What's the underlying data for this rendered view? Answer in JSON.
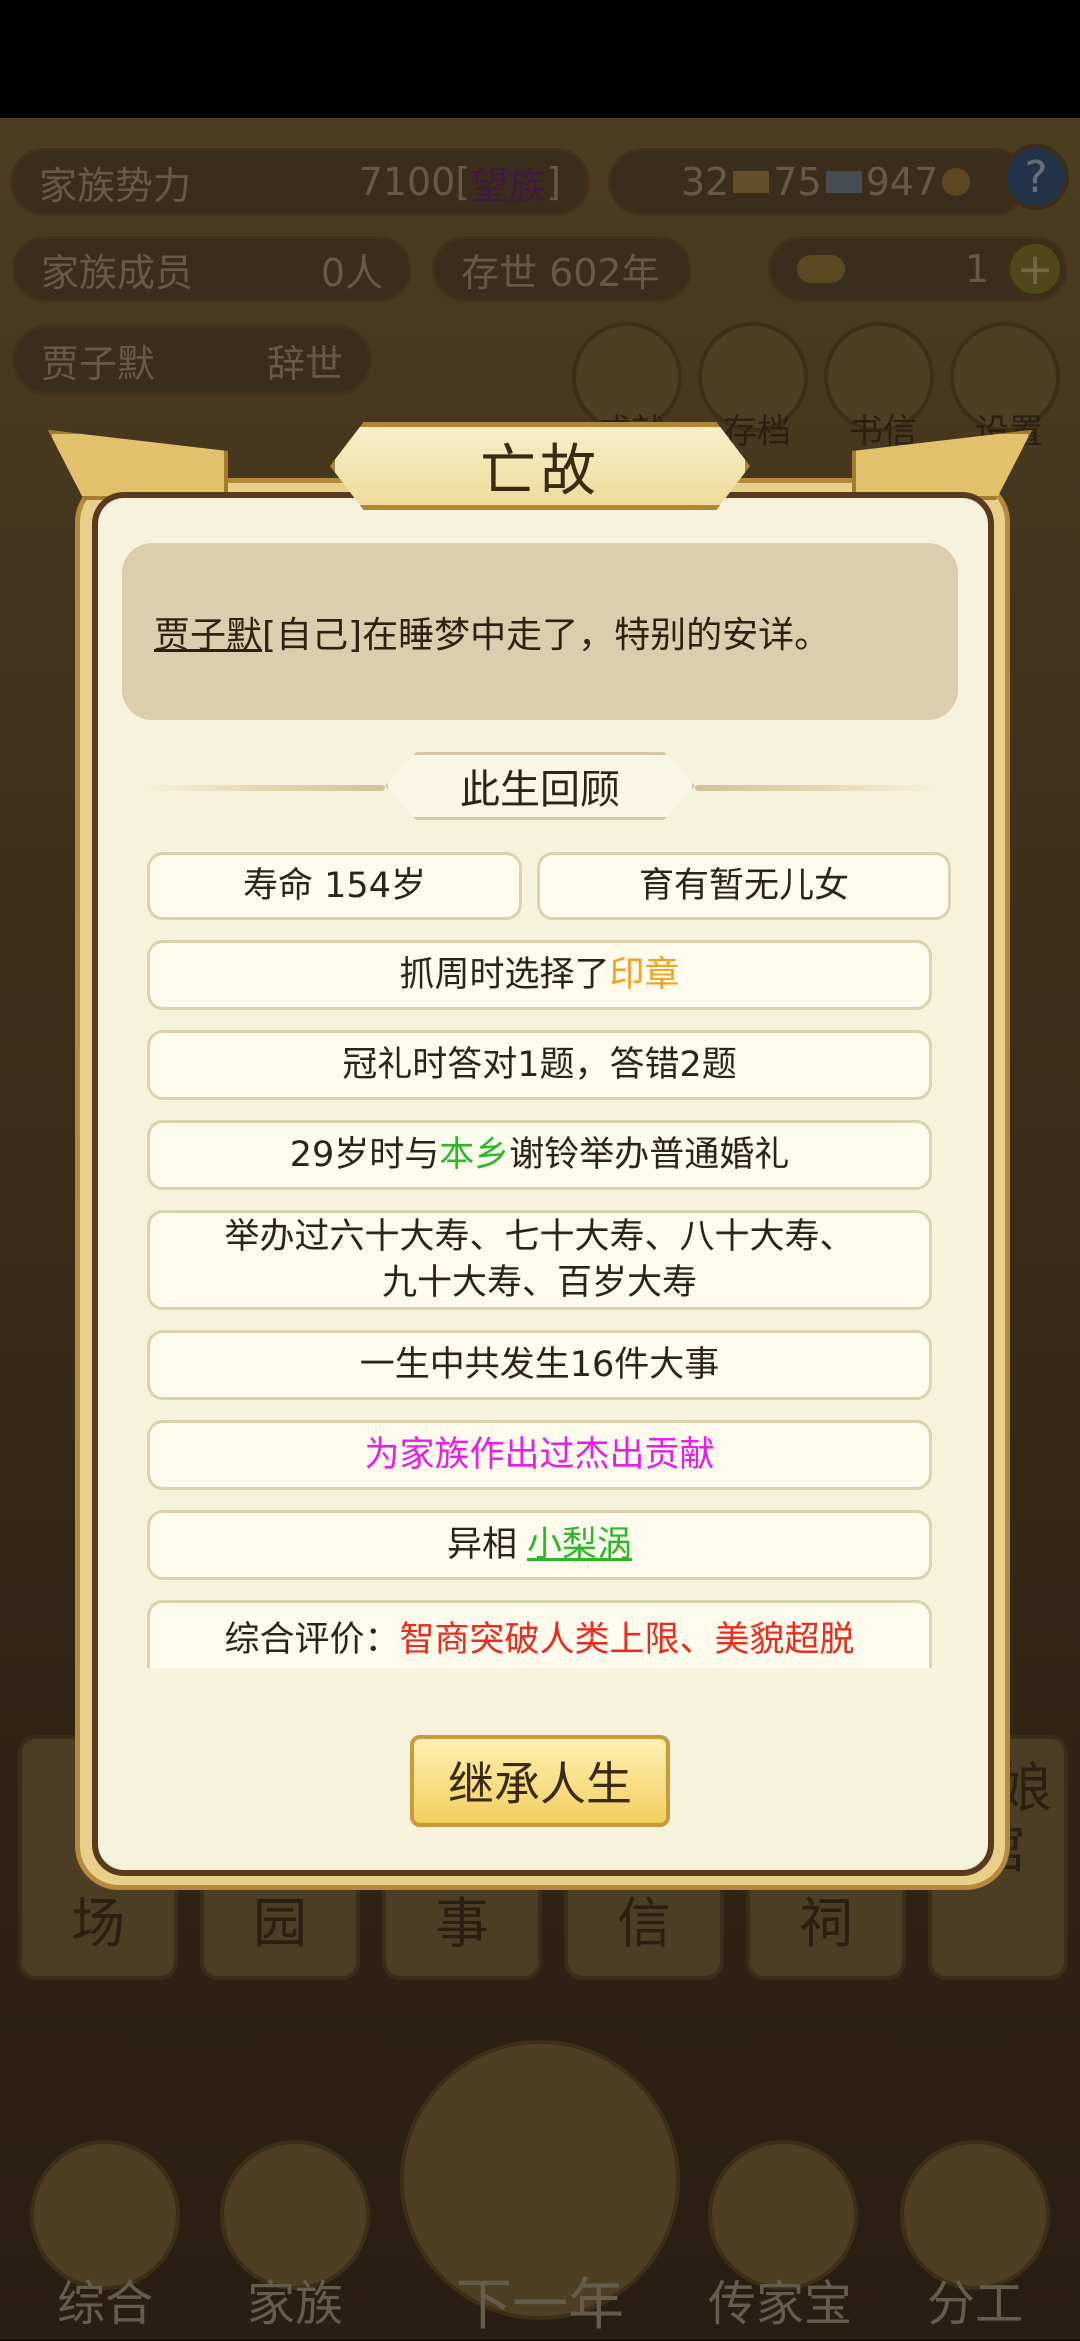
{
  "hud": {
    "power_label": "家族势力",
    "power_value": "7100",
    "power_bracket_open": "[",
    "power_bracket_close": "]",
    "power_rank": "望族",
    "stat_a": "32",
    "stat_b": "75",
    "stat_c": "947",
    "help_label": "?",
    "members_label": "家族成员",
    "members_value": "0人",
    "age_label": "存世 602年",
    "ingot_count": "1",
    "plus_label": "+",
    "person_name": "贾子默",
    "person_status": "辞世",
    "top_buttons": [
      "成就",
      "存档",
      "书信",
      "设置"
    ]
  },
  "side_tiles": [
    "场",
    "园",
    "事",
    "信",
    "祠",
    "红娘馆"
  ],
  "bottom_nav": [
    "综合",
    "家族",
    "下一年",
    "传家宝",
    "分工"
  ],
  "modal": {
    "title": "亡故",
    "message_name": "贾子默",
    "message_rest": "[自己]在睡梦中走了，特别的安详。",
    "section_title": "此生回顾",
    "lifespan": "寿命 154岁",
    "children": "育有暂无儿女",
    "zhuazhou_prefix": "抓周时选择了",
    "zhuazhou_item": "印章",
    "guanli": "冠礼时答对1题，答错2题",
    "marriage_prefix": "29岁时与",
    "marriage_place": "本乡",
    "marriage_suffix": "谢铃举办普通婚礼",
    "birthdays_line1": "举办过六十大寿、七十大寿、八十大寿、",
    "birthdays_line2": "九十大寿、百岁大寿",
    "events": "一生中共发生16件大事",
    "contribution": "为家族作出过杰出贡献",
    "trait_prefix": "异相",
    "trait_value": "小梨涡",
    "eval_prefix": "综合评价：",
    "eval_a": "智商突破人类上限",
    "eval_sep": "、",
    "eval_b": "美貌超脱",
    "inherit_button": "继承人生"
  },
  "colors": {
    "highlight_orange": "#f3a21f",
    "highlight_green": "#2cb82c",
    "highlight_magenta": "#e91de8",
    "highlight_red": "#ea2b1d"
  }
}
